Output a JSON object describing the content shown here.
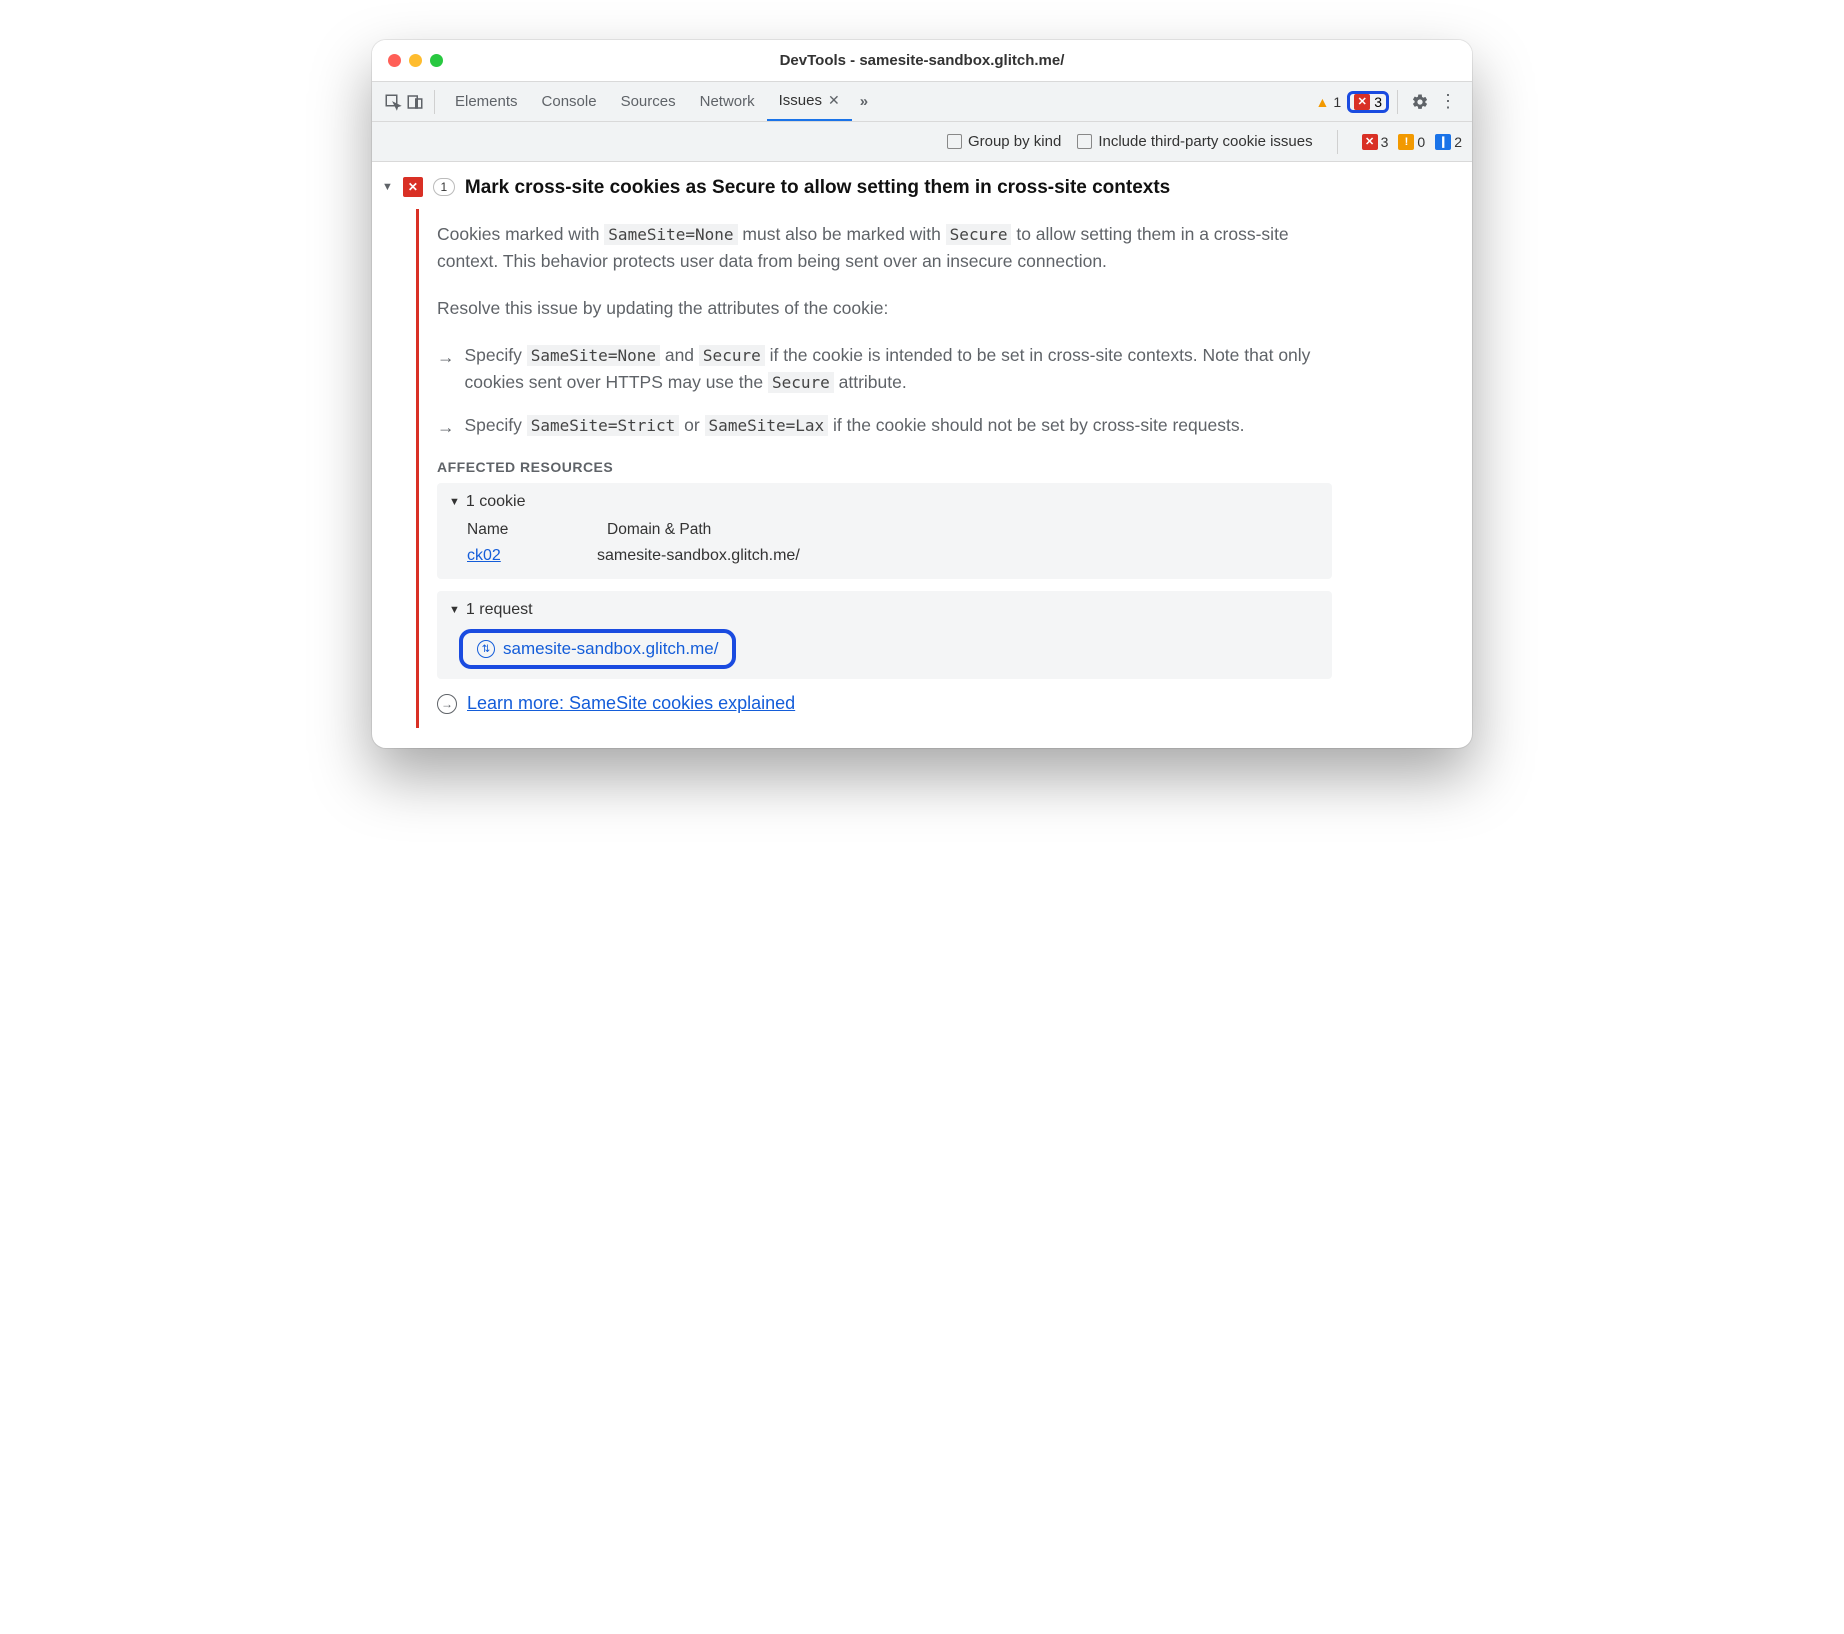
{
  "window": {
    "title": "DevTools - samesite-sandbox.glitch.me/"
  },
  "tabs": {
    "elements": "Elements",
    "console": "Console",
    "sources": "Sources",
    "network": "Network",
    "issues": "Issues"
  },
  "header_badges": {
    "warn_count": "1",
    "err_count": "3"
  },
  "toolbar2": {
    "group_by_kind": "Group by kind",
    "third_party": "Include third-party cookie issues",
    "err_count": "3",
    "warn_count": "0",
    "msg_count": "2"
  },
  "issue": {
    "count": "1",
    "title": "Mark cross-site cookies as Secure to allow setting them in cross-site contexts",
    "desc_pre": "Cookies marked with ",
    "desc_code1": "SameSite=None",
    "desc_mid": " must also be marked with ",
    "desc_code2": "Secure",
    "desc_post": " to allow setting them in a cross-site context. This behavior protects user data from being sent over an insecure connection.",
    "resolve_intro": "Resolve this issue by updating the attributes of the cookie:",
    "b1_a": "Specify ",
    "b1_c1": "SameSite=None",
    "b1_b": " and ",
    "b1_c2": "Secure",
    "b1_c": " if the cookie is intended to be set in cross-site contexts. Note that only cookies sent over HTTPS may use the ",
    "b1_c3": "Secure",
    "b1_d": " attribute.",
    "b2_a": "Specify ",
    "b2_c1": "SameSite=Strict",
    "b2_b": " or ",
    "b2_c2": "SameSite=Lax",
    "b2_c": " if the cookie should not be set by cross-site requests.",
    "affected_title": "AFFECTED RESOURCES",
    "cookie_section": "1 cookie",
    "col_name": "Name",
    "col_domain": "Domain & Path",
    "cookie_name": "ck02",
    "cookie_domain": "samesite-sandbox.glitch.me/",
    "request_section": "1 request",
    "request_url": "samesite-sandbox.glitch.me/",
    "learn_more": "Learn more: SameSite cookies explained"
  }
}
